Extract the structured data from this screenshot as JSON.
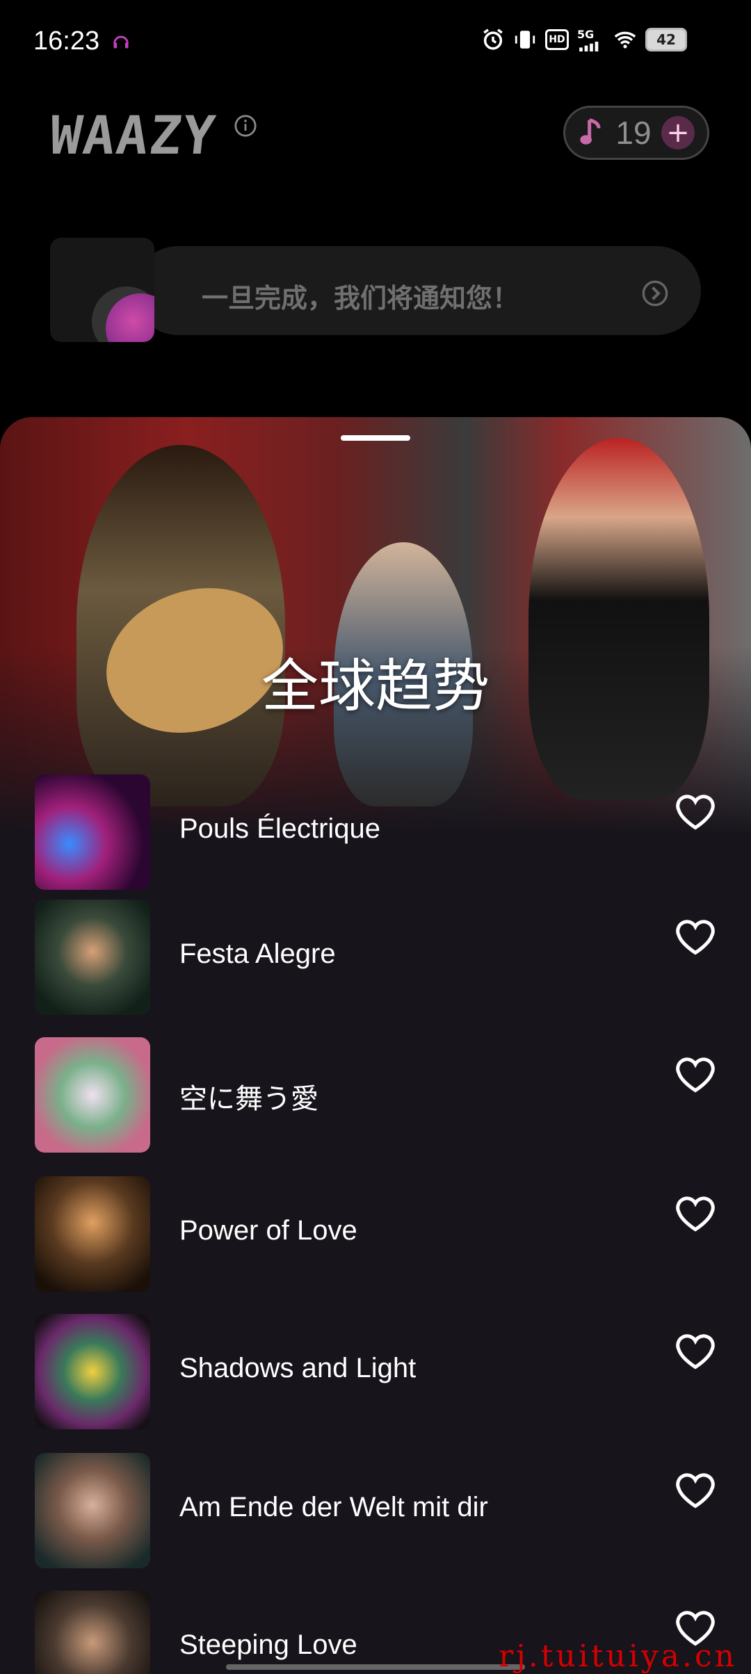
{
  "status_bar": {
    "time": "16:23",
    "icons": [
      "headphones-icon",
      "alarm-icon",
      "vibrate-icon",
      "hd-icon",
      "signal-5g-icon",
      "wifi-icon",
      "battery-icon"
    ],
    "hd_label": "HD",
    "network_label": "5G",
    "battery_level": "42"
  },
  "header": {
    "logo_text": "WAAZY",
    "credits": "19",
    "plus_label": "+"
  },
  "notification": {
    "text": "一旦完成，我们将通知您！"
  },
  "trending": {
    "title": "全球趋势",
    "tracks": [
      {
        "title": "Pouls Électrique"
      },
      {
        "title": "Festa Alegre"
      },
      {
        "title": "空に舞う愛"
      },
      {
        "title": "Power of Love"
      },
      {
        "title": "Shadows and Light"
      },
      {
        "title": "Am Ende der Welt mit dir"
      },
      {
        "title": "Steeping Love"
      }
    ]
  },
  "watermark": "rj.tuituiya.cn",
  "colors": {
    "background": "#000000",
    "sheet": "#17141b",
    "accent": "#d04aa8"
  }
}
